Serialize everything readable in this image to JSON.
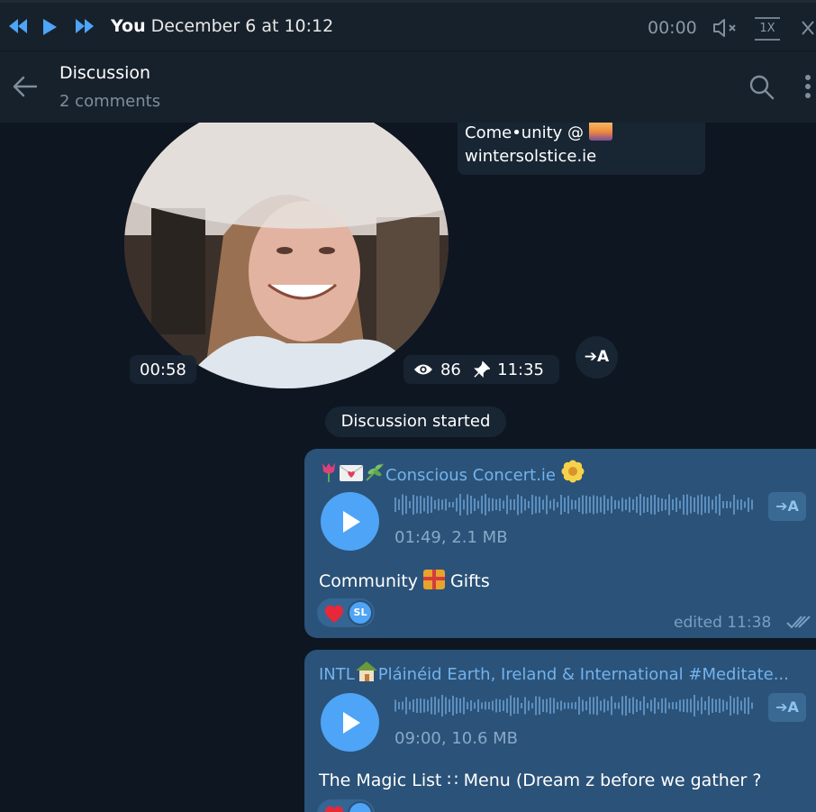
{
  "player": {
    "author": "You",
    "date": "December 6 at 10:12",
    "time": "00:00",
    "speed": "1X"
  },
  "header": {
    "title": "Discussion",
    "subtitle": "2 comments"
  },
  "video_post": {
    "caption_line1": "Come•unity @ ",
    "caption_line2": "wintersolstice.ie",
    "duration": "00:58",
    "views": "86",
    "time": "11:35",
    "translate_label": "➔A"
  },
  "service_message": "Discussion started",
  "messages": [
    {
      "sender": "Conscious Concert.ie",
      "audio_info": "01:49, 2.1 MB",
      "transcribe_label": "➔A",
      "caption": "Community",
      "caption_suffix": " Gifts",
      "reaction_avatar": "SL",
      "status": "edited 11:38"
    },
    {
      "sender": "INTL",
      "sender_rest": "Pláinéid Earth, Ireland & International #Meditate...",
      "audio_info": "09:00, 10.6 MB",
      "transcribe_label": "➔A",
      "caption": "The Magic List ∷ Menu (Dream z before we gather ?"
    }
  ],
  "icons": {
    "prev": "skip-back-icon",
    "play": "play-icon",
    "next": "skip-forward-icon",
    "mute": "volume-muted-icon",
    "close": "close-icon",
    "back": "arrow-left-icon",
    "search": "search-icon",
    "menu": "more-vertical-icon",
    "views": "eye-icon",
    "pin": "pin-icon",
    "heart": "heart-icon",
    "checks": "double-check-icon"
  },
  "colors": {
    "background": "#0e1621",
    "header": "#17212b",
    "bubble_out": "#2b5278",
    "accent": "#4ea4f6",
    "link": "#72b3ee"
  }
}
